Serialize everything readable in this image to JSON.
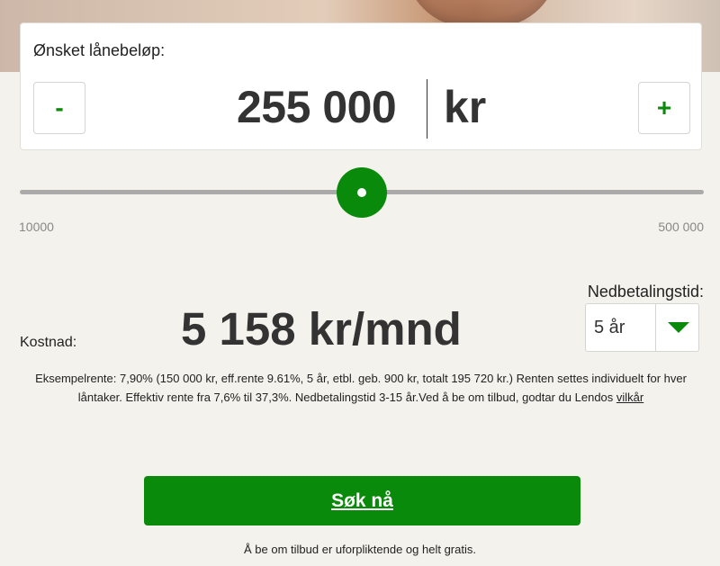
{
  "loan": {
    "label": "Ønsket lånebeløp:",
    "amount": "255 000",
    "currency": "kr",
    "decrement_label": "-",
    "increment_label": "+"
  },
  "slider": {
    "min_label": "10000",
    "max_label": "500 000",
    "min": 10000,
    "max": 500000,
    "value": 255000
  },
  "term": {
    "label": "Nedbetalingstid:",
    "selected": "5 år"
  },
  "cost": {
    "label": "Kostnad:",
    "value": "5 158 kr/mnd"
  },
  "disclaimer": {
    "text": "Eksempelrente: 7,90% (150 000 kr, eff.rente 9.61%, 5 år, etbl. geb. 900 kr, totalt 195 720 kr.) Renten settes individuelt for hver låntaker. Effektiv rente fra 7,6% til 37,3%. Nedbetalingstid 3-15 år.Ved å be om tilbud, godtar du Lendos ",
    "link": "vilkår"
  },
  "cta": {
    "label": "Søk nå"
  },
  "footnote": "Å be om tilbud er uforpliktende og helt gratis.",
  "colors": {
    "accent": "#0a8a0a",
    "background": "#f4f2ec",
    "track": "#aaaaaa"
  },
  "icons": {
    "term_dropdown": "chevron-down-icon"
  }
}
